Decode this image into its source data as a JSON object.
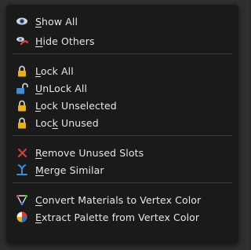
{
  "menu": {
    "items": [
      {
        "label": "Show All",
        "ul": "S",
        "icon": "eye-icon"
      },
      {
        "label": "Hide Others",
        "ul": "H",
        "icon": "hide-others-icon"
      },
      {
        "label": "Lock All",
        "ul": "L",
        "icon": "lock-icon"
      },
      {
        "label": "UnLock All",
        "ul": "U",
        "icon": "unlock-icon"
      },
      {
        "label": "Lock Unselected",
        "ul": "L",
        "icon": "lock-icon"
      },
      {
        "label": "Lock Unused",
        "ul": "k",
        "icon": "lock-icon"
      },
      {
        "label": "Remove Unused Slots",
        "ul": "R",
        "icon": "remove-x-icon"
      },
      {
        "label": "Merge Similar",
        "ul": "M",
        "icon": "merge-icon"
      },
      {
        "label": "Convert Materials to Vertex Color",
        "ul": "C",
        "icon": "vertex-color-icon"
      },
      {
        "label": "Extract Palette from Vertex Color",
        "ul": "E",
        "icon": "palette-icon"
      }
    ]
  },
  "colors": {
    "menu_bg": "#1a1a1a",
    "text": "#e6e6e6",
    "lock": "#e8b020",
    "remove": "#e03a2a",
    "merge": "#3a8fd8"
  }
}
